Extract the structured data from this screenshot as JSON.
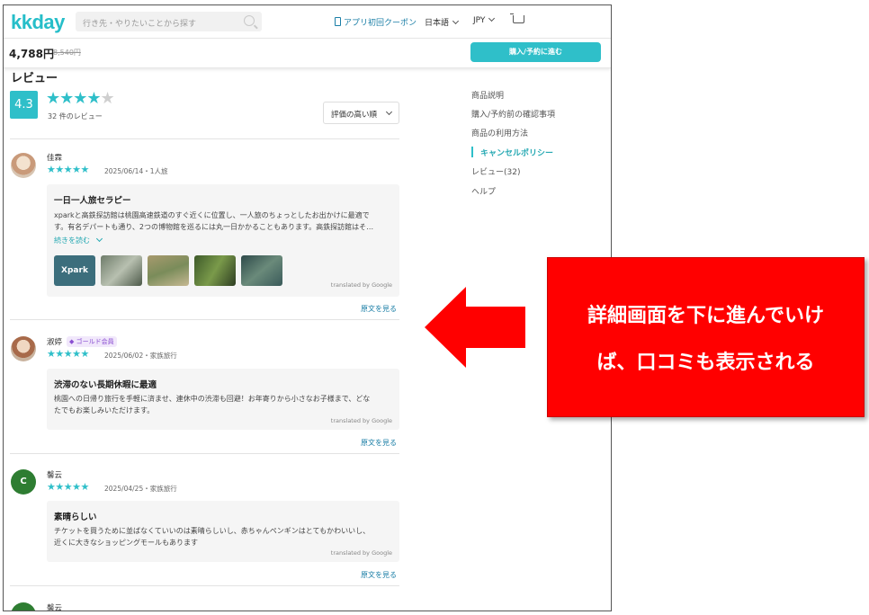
{
  "header": {
    "logo": "kkday",
    "search_placeholder": "行き先・やりたいことから探す",
    "coupon": "アプリ初回クーポン",
    "language": "日本語",
    "currency": "JPY"
  },
  "pricebar": {
    "price": "4,788円",
    "old_price": "8,540円",
    "cta": "購入/予約に進む"
  },
  "reviews": {
    "title": "レビュー",
    "score": "4.3",
    "rating": 4.3,
    "count_label": "32 件のレビュー",
    "sort_label": "評価の高い順",
    "items": [
      {
        "name": "佳霖",
        "stars": "★★★★★",
        "date": "2025/06/14・1人旅",
        "title": "一日一人旅セラピー",
        "body1": "xparkと高鉄探訪館は桃園高速鉄道のすぐ近くに位置し、一人旅のちょっとしたお出かけに最適で",
        "body2": "す。有名デパートも通り、2つの博物館を巡るには丸一日かかることもあります。高鉄探訪館はそ…",
        "more": "続きを読む",
        "thumb_text": "Xpark",
        "translated": "translated by Google",
        "original": "原文を見る"
      },
      {
        "name": "淑婷",
        "badge": "ゴールド会員",
        "stars": "★★★★★",
        "date": "2025/06/02・家族旅行",
        "title": "渋滞のない長期休暇に最適",
        "body1": "桃園への日帰り旅行を手軽に済ませ、連休中の渋滞も回避！お年寄りから小さなお子様まで、どな",
        "body2": "たでもお楽しみいただけます。",
        "translated": "translated by Google",
        "original": "原文を見る"
      },
      {
        "name": "馨云",
        "initial": "C",
        "stars": "★★★★★",
        "date": "2025/04/25・家族旅行",
        "title": "素晴らしい",
        "body1": "チケットを買うために並ばなくていいのは素晴らしいし、赤ちゃんペンギンはとてもかわいいし、",
        "body2": "近くに大きなショッピングモールもあります",
        "translated": "translated by Google",
        "original": "原文を見る"
      },
      {
        "name": "馨云"
      }
    ]
  },
  "sidebar": {
    "items": [
      "商品説明",
      "購入/予約前の確認事項",
      "商品の利用方法",
      "キャンセルポリシー",
      "レビュー(32)",
      "ヘルプ"
    ],
    "active": "キャンセルポリシー"
  },
  "callout": {
    "line1": "詳細画面を下に進んでいけ",
    "line2": "ば、口コミも表示される"
  },
  "colors": {
    "accent": "#2fbfc9",
    "callout": "#ff0000",
    "link": "#1a7ea6"
  }
}
